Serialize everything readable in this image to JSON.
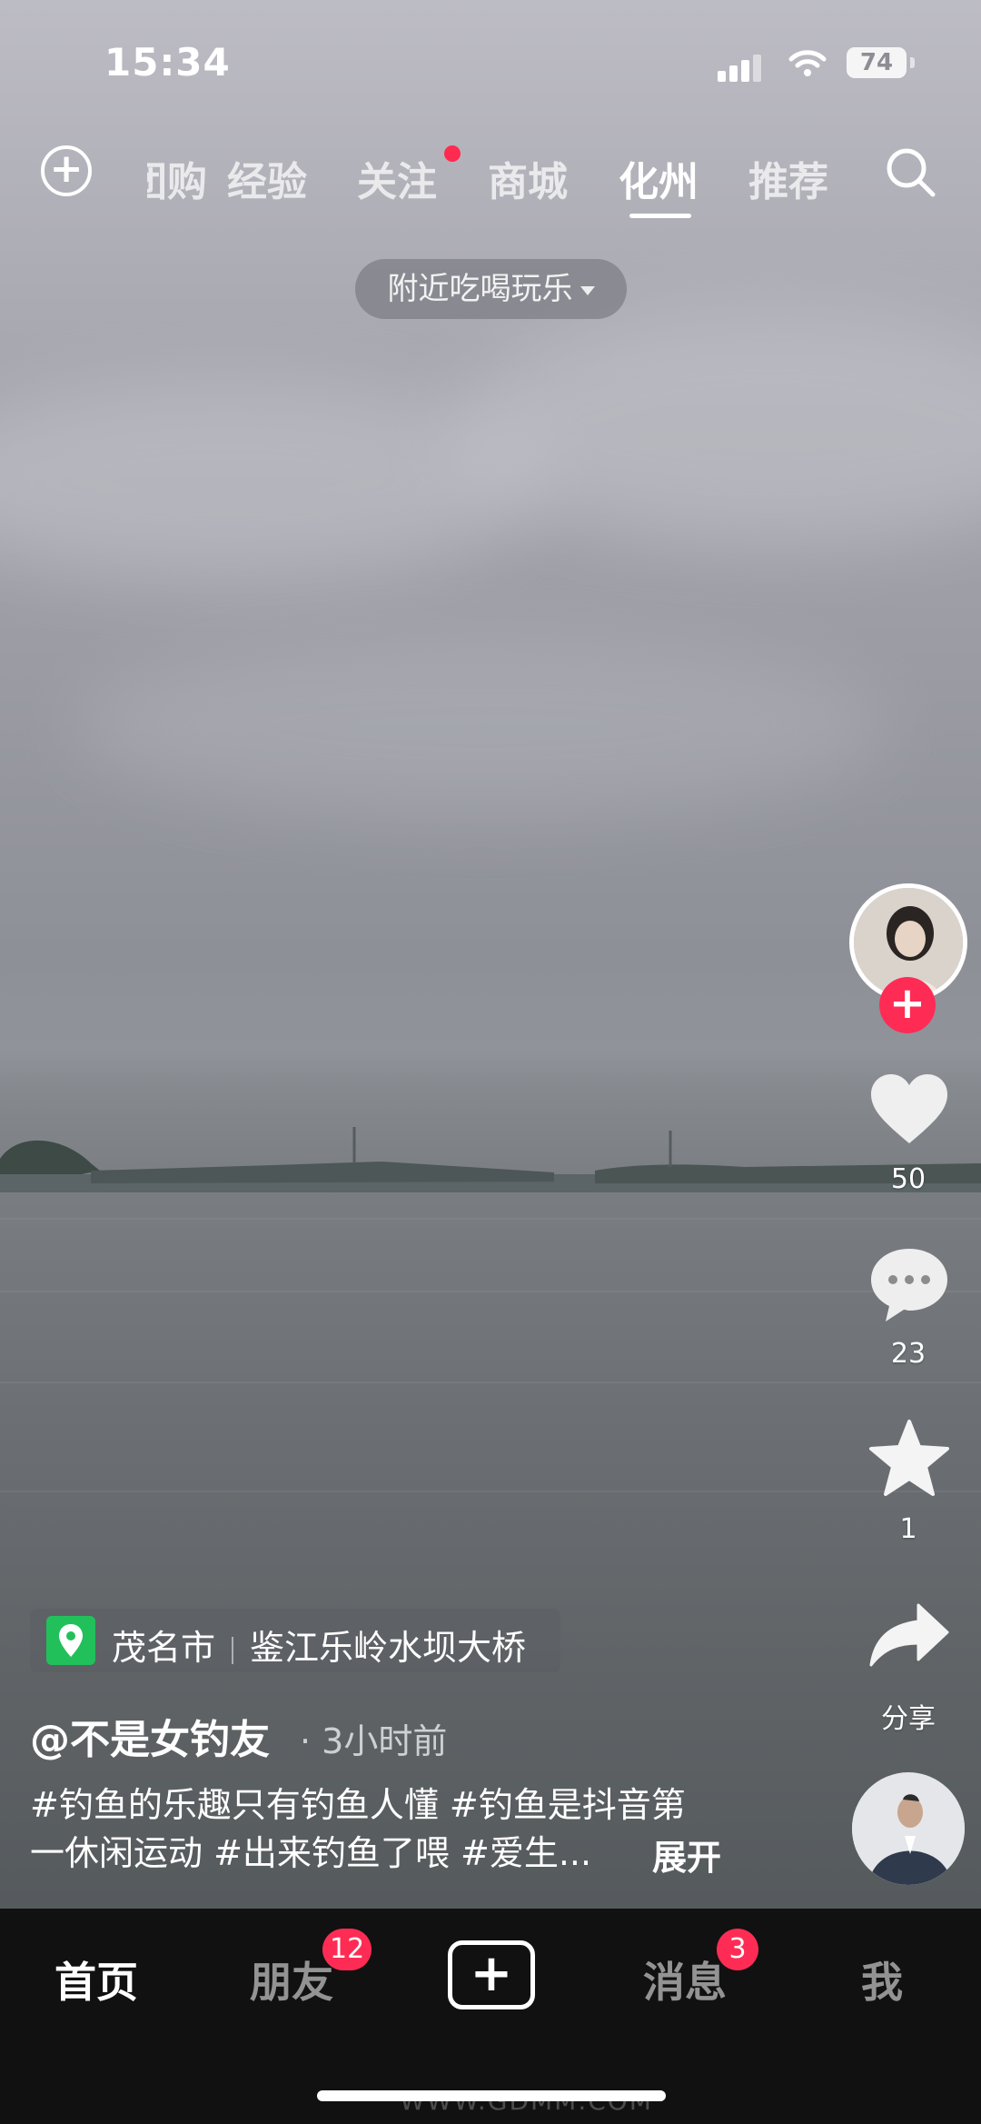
{
  "status_bar": {
    "time": "15:34",
    "battery": "74"
  },
  "top_nav": {
    "tabs": [
      {
        "label": "团购"
      },
      {
        "label": "经验"
      },
      {
        "label": "关注"
      },
      {
        "label": "商城"
      },
      {
        "label": "化州"
      },
      {
        "label": "推荐"
      }
    ],
    "nearby_pill": "附近吃喝玩乐"
  },
  "rail": {
    "likes": "50",
    "comments": "23",
    "favorites": "1",
    "share_label": "分享"
  },
  "post": {
    "location_city": "茂名市",
    "location_place": "鉴江乐岭水坝大桥",
    "author": "@不是女钓友",
    "time_ago": "· 3小时前",
    "caption_line1": "#钓鱼的乐趣只有钓鱼人懂 #钓鱼是抖音第",
    "caption_line2": "一休闲运动 #出来钓鱼了喂 #爱生...",
    "expand_label": "展开"
  },
  "bottom_nav": {
    "home": "首页",
    "friends": "朋友",
    "friends_badge": "12",
    "messages": "消息",
    "messages_badge": "3",
    "me": "我"
  },
  "watermark": "WWW.GDMM.COM"
}
